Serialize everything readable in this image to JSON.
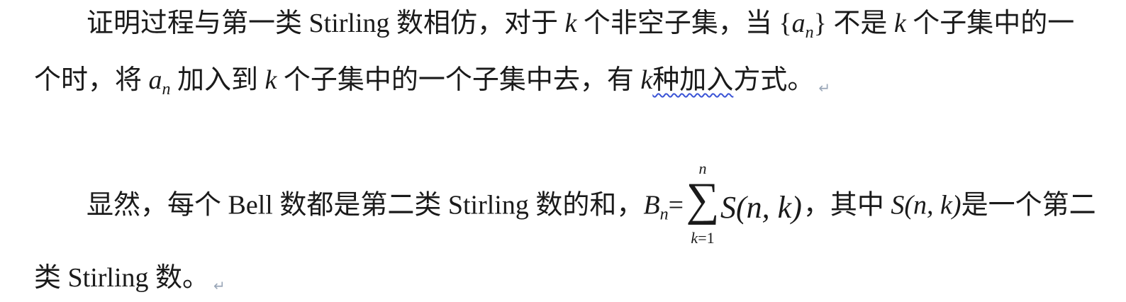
{
  "doc": {
    "line1": {
      "a": "证明过程与第一类 Stirling 数相仿，对于 ",
      "k1": "k",
      "b": " 个非空子集，当 {",
      "a_var": "a",
      "a_sub": "n",
      "c": "} 不是 ",
      "k2": "k",
      "d": " 个子集中的一"
    },
    "line2": {
      "a": "个时，将 ",
      "a_var": "a",
      "a_sub": "n",
      "b": " 加入到 ",
      "k1": "k",
      "c": " 个子集中的一个子集中去，有 ",
      "k2": "k",
      "d_under": "种加入",
      "e": "方式。",
      "mark": "↵"
    },
    "line3": {
      "a": "显然，每个 Bell 数都是第二类 Stirling 数的和，",
      "B": "B",
      "B_sub": "n",
      "eq": "=",
      "sum_top": "n",
      "sum_sign": "∑",
      "sum_bot_var": "k",
      "sum_bot_rest": "=1",
      "S": "S",
      "S_args": "(n, k)",
      "b": "，其中 ",
      "S2": "S",
      "S2_args": "(n, k)",
      "c": "是一个第二"
    },
    "line4": {
      "a": "类 Stirling 数。",
      "mark": "↵"
    }
  }
}
